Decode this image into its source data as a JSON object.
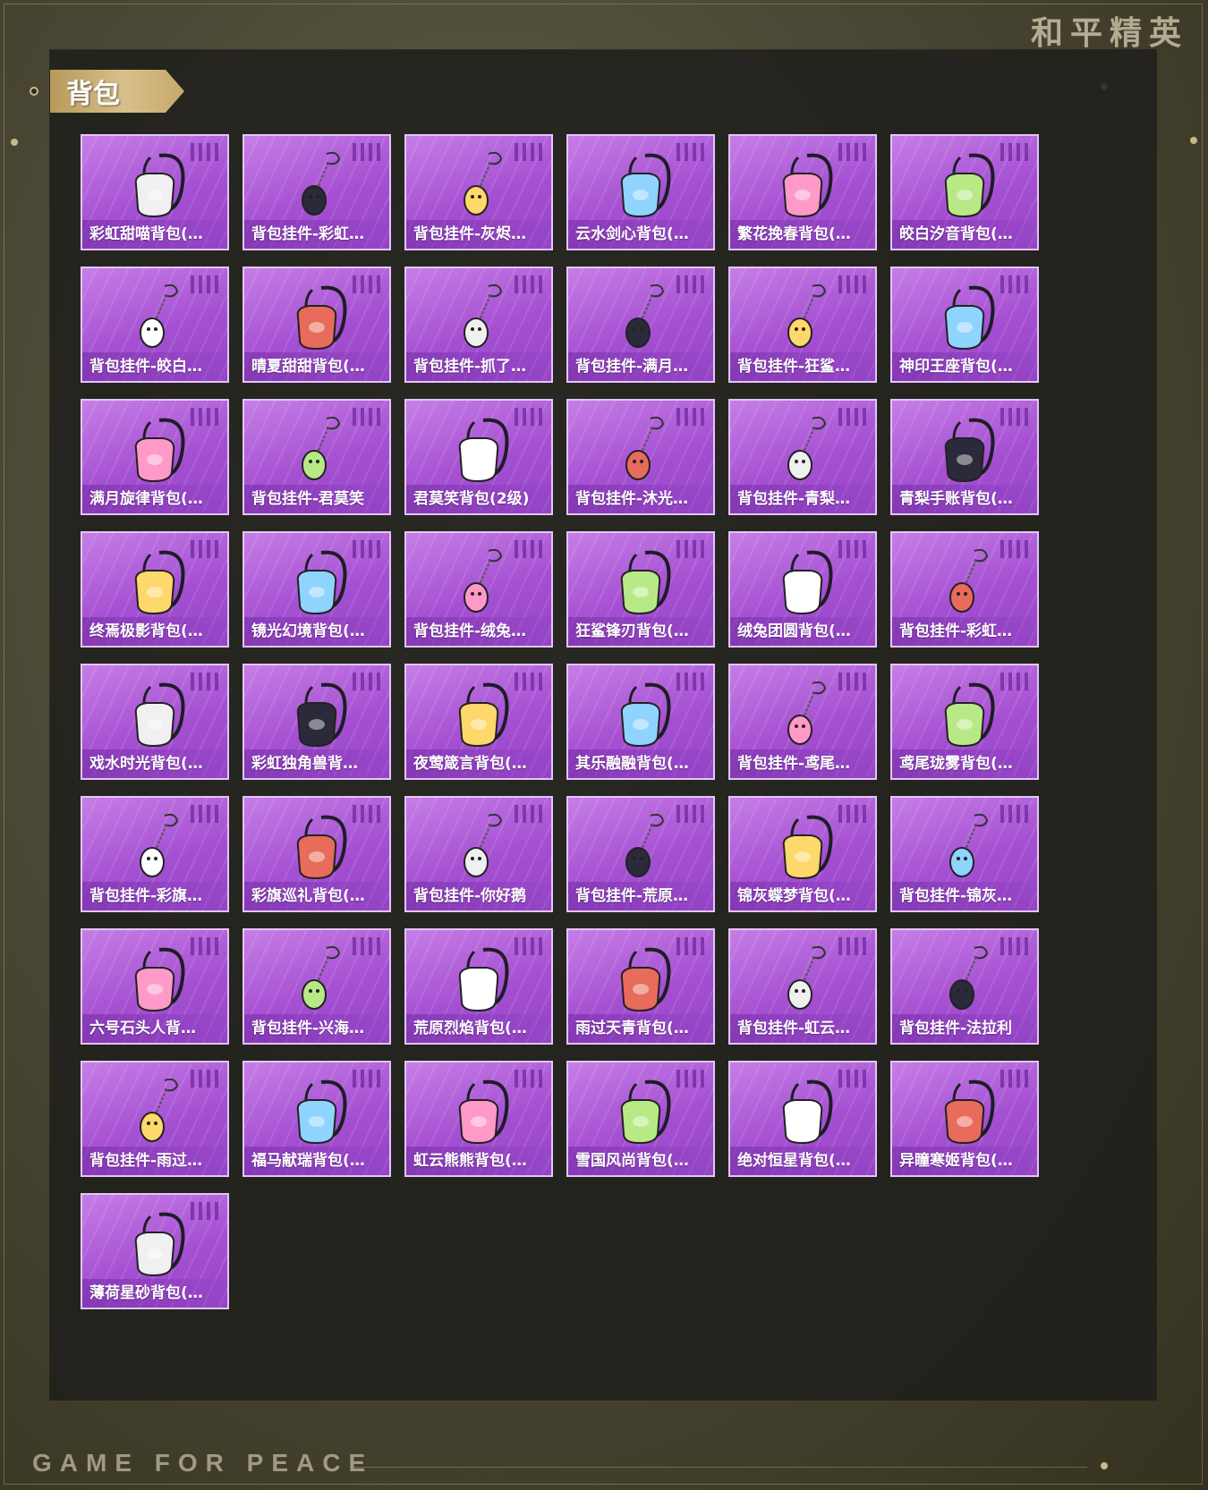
{
  "brand": {
    "top_right": "和平精英",
    "footer": "GAME FOR PEACE"
  },
  "section": {
    "title": "背包"
  },
  "colors": {
    "card_purple": "#a550d2",
    "card_border": "#e3c5f7",
    "gold": "#d9c08a"
  },
  "items": [
    {
      "label": "彩虹甜喵背包(…",
      "icon": "cat-backpack-icon"
    },
    {
      "label": "背包挂件-彩虹…",
      "icon": "paw-charm-icon"
    },
    {
      "label": "背包挂件-灰烬…",
      "icon": "winged-charm-icon"
    },
    {
      "label": "云水剑心背包(…",
      "icon": "sword-backpack-icon"
    },
    {
      "label": "繁花挽春背包(…",
      "icon": "flower-backpack-icon"
    },
    {
      "label": "皎白汐音背包(…",
      "icon": "shell-backpack-icon"
    },
    {
      "label": "背包挂件-皎白…",
      "icon": "moon-charm-icon"
    },
    {
      "label": "晴夏甜甜背包(…",
      "icon": "peach-backpack-icon"
    },
    {
      "label": "背包挂件-抓了…",
      "icon": "anchor-charm-icon"
    },
    {
      "label": "背包挂件-满月…",
      "icon": "ring-charm-icon"
    },
    {
      "label": "背包挂件-狂鲨…",
      "icon": "fin-charm-icon"
    },
    {
      "label": "神印王座背包(…",
      "icon": "crest-backpack-icon"
    },
    {
      "label": "满月旋律背包(…",
      "icon": "wing-backpack-icon"
    },
    {
      "label": "背包挂件-君莫笑",
      "icon": "umbrella-charm-icon"
    },
    {
      "label": "君莫笑背包(2级)",
      "icon": "emblem-backpack-icon"
    },
    {
      "label": "背包挂件-沐光…",
      "icon": "cat-charm-icon"
    },
    {
      "label": "背包挂件-青梨…",
      "icon": "pear-charm-icon"
    },
    {
      "label": "青梨手账背包(…",
      "icon": "snail-backpack-icon"
    },
    {
      "label": "终焉极影背包(…",
      "icon": "cage-backpack-icon"
    },
    {
      "label": "镜光幻境背包(…",
      "icon": "mirror-backpack-icon"
    },
    {
      "label": "背包挂件-绒兔…",
      "icon": "bunny-charm-icon"
    },
    {
      "label": "狂鲨锋刃背包(…",
      "icon": "shark-backpack-icon"
    },
    {
      "label": "绒兔团圆背包(…",
      "icon": "bunny-backpack-icon"
    },
    {
      "label": "背包挂件-彩虹…",
      "icon": "bow-charm-icon"
    },
    {
      "label": "戏水时光背包(…",
      "icon": "duck-backpack-icon"
    },
    {
      "label": "彩虹独角兽背…",
      "icon": "unicorn-backpack-icon"
    },
    {
      "label": "夜莺箴言背包(…",
      "icon": "bird-backpack-icon"
    },
    {
      "label": "其乐融融背包(…",
      "icon": "cake-backpack-icon"
    },
    {
      "label": "背包挂件-鸢尾…",
      "icon": "iris-charm-icon"
    },
    {
      "label": "鸢尾珑雾背包(…",
      "icon": "mist-backpack-icon"
    },
    {
      "label": "背包挂件-彩旗…",
      "icon": "icecream-charm-icon"
    },
    {
      "label": "彩旗巡礼背包(…",
      "icon": "ribbon-backpack-icon"
    },
    {
      "label": "背包挂件-你好鹅",
      "icon": "penguin-charm-icon"
    },
    {
      "label": "背包挂件-荒原…",
      "icon": "star-charm-icon"
    },
    {
      "label": "锦灰蝶梦背包(…",
      "icon": "butterfly-backpack-icon"
    },
    {
      "label": "背包挂件-锦灰…",
      "icon": "feather-charm-icon"
    },
    {
      "label": "六号石头人背…",
      "icon": "golem-backpack-icon"
    },
    {
      "label": "背包挂件-兴海…",
      "icon": "tag-charm-icon"
    },
    {
      "label": "荒原烈焰背包(…",
      "icon": "flame-backpack-icon"
    },
    {
      "label": "雨过天青背包(…",
      "icon": "drop-backpack-icon"
    },
    {
      "label": "背包挂件-虹云…",
      "icon": "pig-charm-icon"
    },
    {
      "label": "背包挂件-法拉利",
      "icon": "shield-charm-icon"
    },
    {
      "label": "背包挂件-雨过…",
      "icon": "wand-charm-icon"
    },
    {
      "label": "福马献瑞背包(…",
      "icon": "horse-backpack-icon"
    },
    {
      "label": "虹云熊熊背包(…",
      "icon": "bear-backpack-icon"
    },
    {
      "label": "雪国风尚背包(…",
      "icon": "snowman-backpack-icon"
    },
    {
      "label": "绝对恒星背包(…",
      "icon": "cup-backpack-icon"
    },
    {
      "label": "异瞳寒姬背包(…",
      "icon": "hood-backpack-icon"
    },
    {
      "label": "薄荷星砂背包(…",
      "icon": "mint-backpack-icon"
    }
  ]
}
